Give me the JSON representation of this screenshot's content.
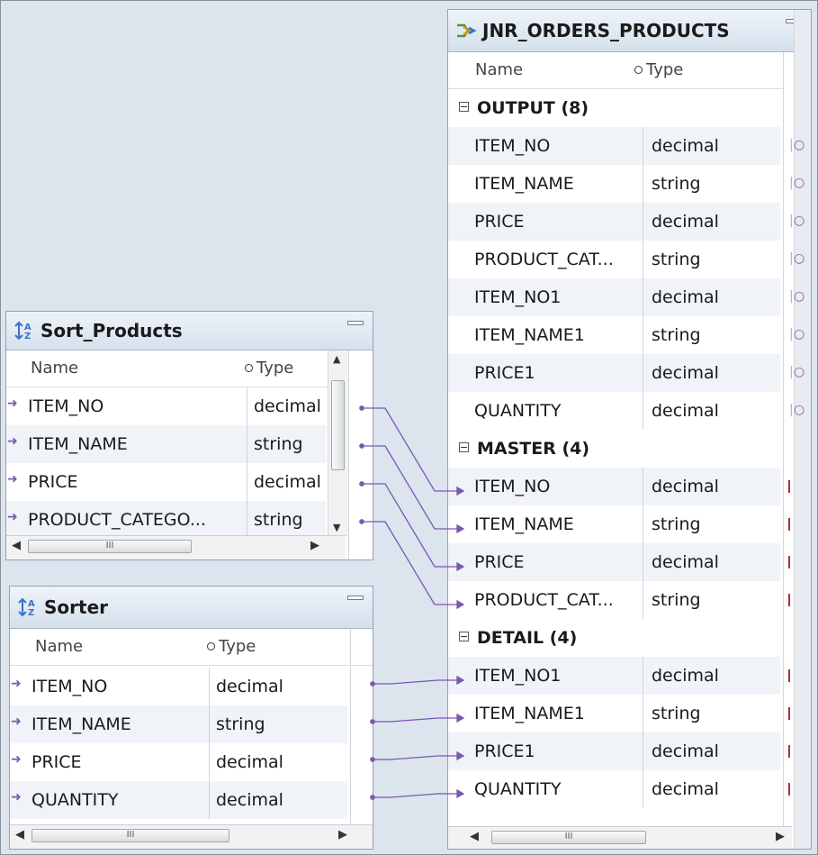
{
  "colors": {
    "accent": "#7a58b0",
    "title_bar": "#d5e0ec",
    "canvas": "#dce4ee",
    "alt_row": "#f0f3f7"
  },
  "icons": {
    "joiner": "joiner-arrows-icon",
    "sorter": "sort-az-icon",
    "minimize": "minimize-icon"
  },
  "columns": {
    "name": "Name",
    "type": "Type"
  },
  "joiner": {
    "title": "JNR_ORDERS_PRODUCTS",
    "groups": [
      {
        "label": "OUTPUT (8)",
        "rows": [
          {
            "name": "ITEM_NO",
            "type": "decimal"
          },
          {
            "name": "ITEM_NAME",
            "type": "string"
          },
          {
            "name": "PRICE",
            "type": "decimal"
          },
          {
            "name": "PRODUCT_CAT...",
            "type": "string"
          },
          {
            "name": "ITEM_NO1",
            "type": "decimal"
          },
          {
            "name": "ITEM_NAME1",
            "type": "string"
          },
          {
            "name": "PRICE1",
            "type": "decimal"
          },
          {
            "name": "QUANTITY",
            "type": "decimal"
          }
        ]
      },
      {
        "label": "MASTER (4)",
        "rows": [
          {
            "name": "ITEM_NO",
            "type": "decimal"
          },
          {
            "name": "ITEM_NAME",
            "type": "string"
          },
          {
            "name": "PRICE",
            "type": "decimal"
          },
          {
            "name": "PRODUCT_CAT...",
            "type": "string"
          }
        ]
      },
      {
        "label": "DETAIL (4)",
        "rows": [
          {
            "name": "ITEM_NO1",
            "type": "decimal"
          },
          {
            "name": "ITEM_NAME1",
            "type": "string"
          },
          {
            "name": "PRICE1",
            "type": "decimal"
          },
          {
            "name": "QUANTITY",
            "type": "decimal"
          }
        ]
      }
    ],
    "scroll_grip": "III"
  },
  "sort_products": {
    "title": "Sort_Products",
    "rows": [
      {
        "name": "ITEM_NO",
        "type": "decimal"
      },
      {
        "name": "ITEM_NAME",
        "type": "string"
      },
      {
        "name": "PRICE",
        "type": "decimal"
      },
      {
        "name": "PRODUCT_CATEGO...",
        "type": "string"
      }
    ],
    "scroll_grip": "III"
  },
  "sorter": {
    "title": "Sorter",
    "rows": [
      {
        "name": "ITEM_NO",
        "type": "decimal"
      },
      {
        "name": "ITEM_NAME",
        "type": "string"
      },
      {
        "name": "PRICE",
        "type": "decimal"
      },
      {
        "name": "QUANTITY",
        "type": "decimal"
      }
    ],
    "scroll_grip": "III"
  }
}
